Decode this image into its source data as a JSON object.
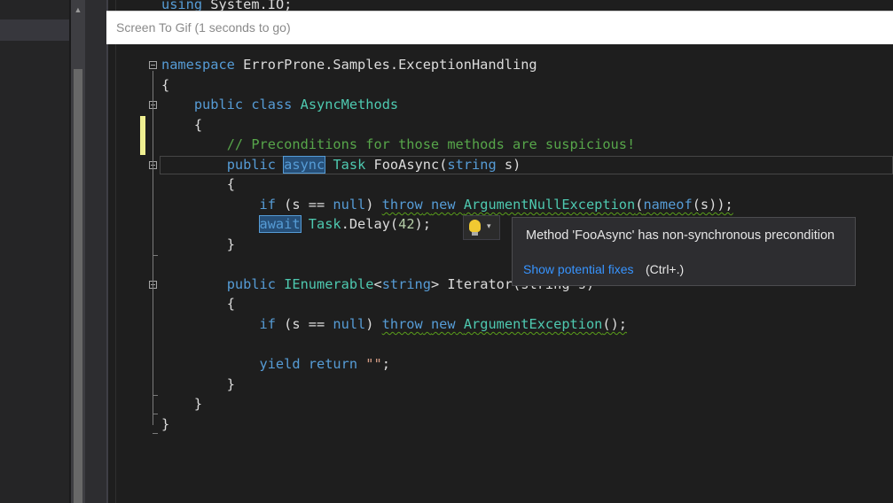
{
  "search_box": {
    "text": "Screen To Gif (1 seconds to go)"
  },
  "code": {
    "line0": {
      "kw": "using",
      "rest": " System.IO;"
    },
    "line1": {
      "kw": "namespace",
      "rest": " ErrorProne.Samples.ExceptionHandling"
    },
    "line2": "{",
    "line3": {
      "kw1": "public",
      "kw2": "class",
      "type": "AsyncMethods"
    },
    "line4": "{",
    "line5": "// Preconditions for those methods are suspicious!",
    "line6": {
      "kw1": "public",
      "kw2": "async",
      "type": "Task",
      "name": "FooAsync",
      "p1": "(",
      "kw3": "string",
      "p2": " s)"
    },
    "line7": "{",
    "line8": {
      "kw1": "if",
      "a": " (s == ",
      "kw2": "null",
      "b": ") ",
      "kw3": "throw",
      "kw4": "new",
      "type": "ArgumentNullException",
      "c": "(",
      "kw5": "nameof",
      "d": "(s));"
    },
    "line9": {
      "kw": "await",
      "type": "Task",
      "rest": ".Delay(",
      "num": "42",
      "end": ");"
    },
    "line10": "}",
    "line11": {
      "kw1": "public",
      "type": "IEnumerable",
      "lt": "<",
      "kw2": "string",
      "gt": ">",
      "name": " Iterator",
      "rest": "(string s)"
    },
    "line12": "{",
    "line13": {
      "kw1": "if",
      "a": " (s == ",
      "kw2": "null",
      "b": ") ",
      "kw3": "throw",
      "kw4": "new",
      "type": "ArgumentException",
      "c": "();"
    },
    "line14": {
      "kw1": "yield",
      "kw2": "return",
      "str": "\"\"",
      "end": ";"
    },
    "line15": "}",
    "line16": "}",
    "line17": "}"
  },
  "lightbulb": {
    "icon": "lightbulb-icon",
    "arrow": "▾"
  },
  "tooltip": {
    "message": "Method 'FooAsync' has non-synchronous precondition",
    "link": "Show potential fixes",
    "shortcut": "(Ctrl+.)"
  },
  "colors": {
    "keyword": "#569cd6",
    "type": "#4ec9b0",
    "comment": "#57a64a",
    "string": "#d69d85",
    "link": "#3794ff",
    "background": "#1e1e1e"
  }
}
